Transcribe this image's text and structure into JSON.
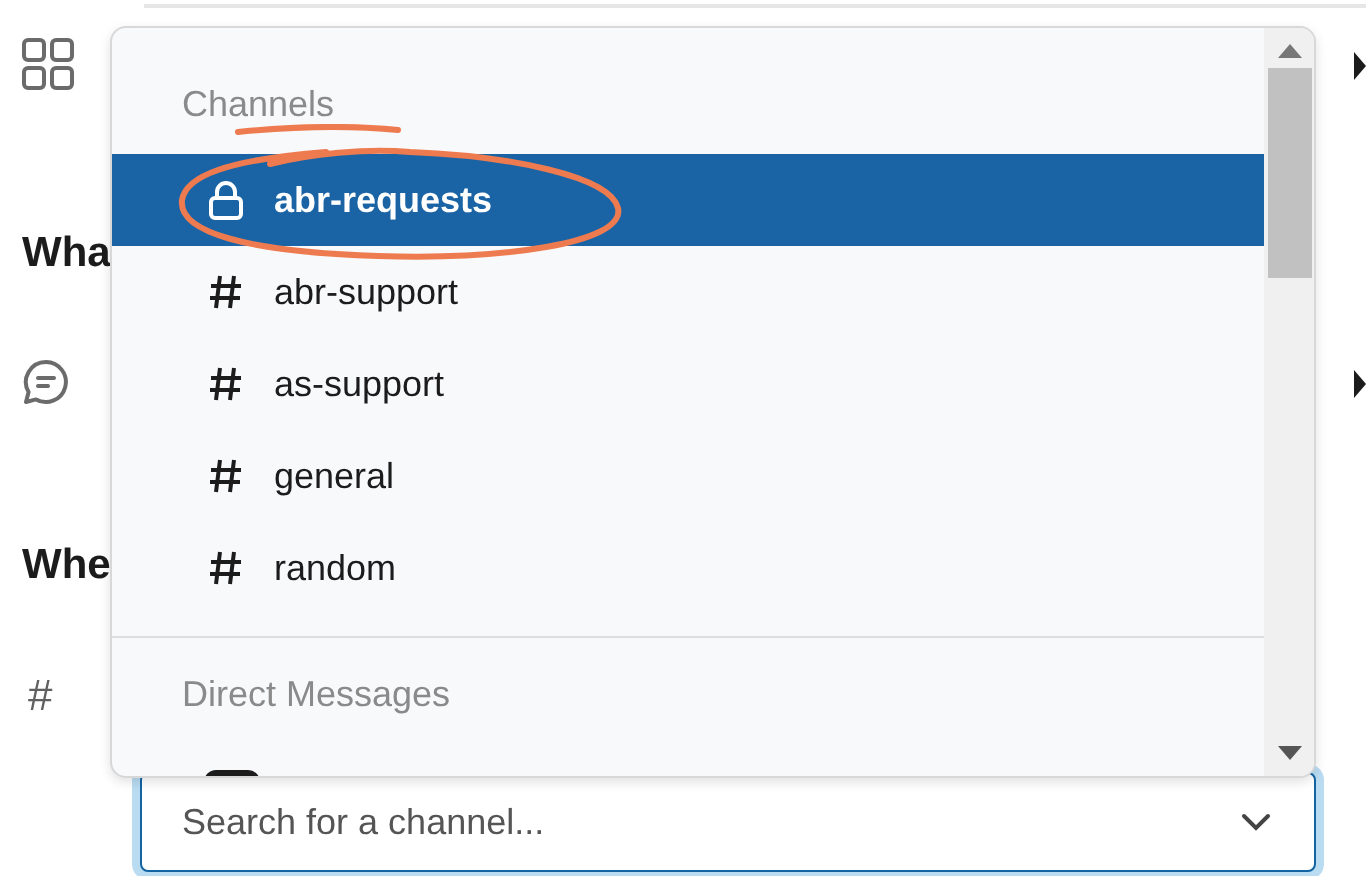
{
  "background": {
    "heading_1": "Wha",
    "heading_2": "Whe",
    "channel_mark": "#"
  },
  "dropdown": {
    "sections": [
      {
        "title": "Channels",
        "items": [
          {
            "name": "abr-requests",
            "kind": "private",
            "selected": true
          },
          {
            "name": "abr-support",
            "kind": "public",
            "selected": false
          },
          {
            "name": "as-support",
            "kind": "public",
            "selected": false
          },
          {
            "name": "general",
            "kind": "public",
            "selected": false
          },
          {
            "name": "random",
            "kind": "public",
            "selected": false
          }
        ]
      },
      {
        "title": "Direct Messages"
      }
    ]
  },
  "search": {
    "placeholder": "Search for a channel..."
  }
}
